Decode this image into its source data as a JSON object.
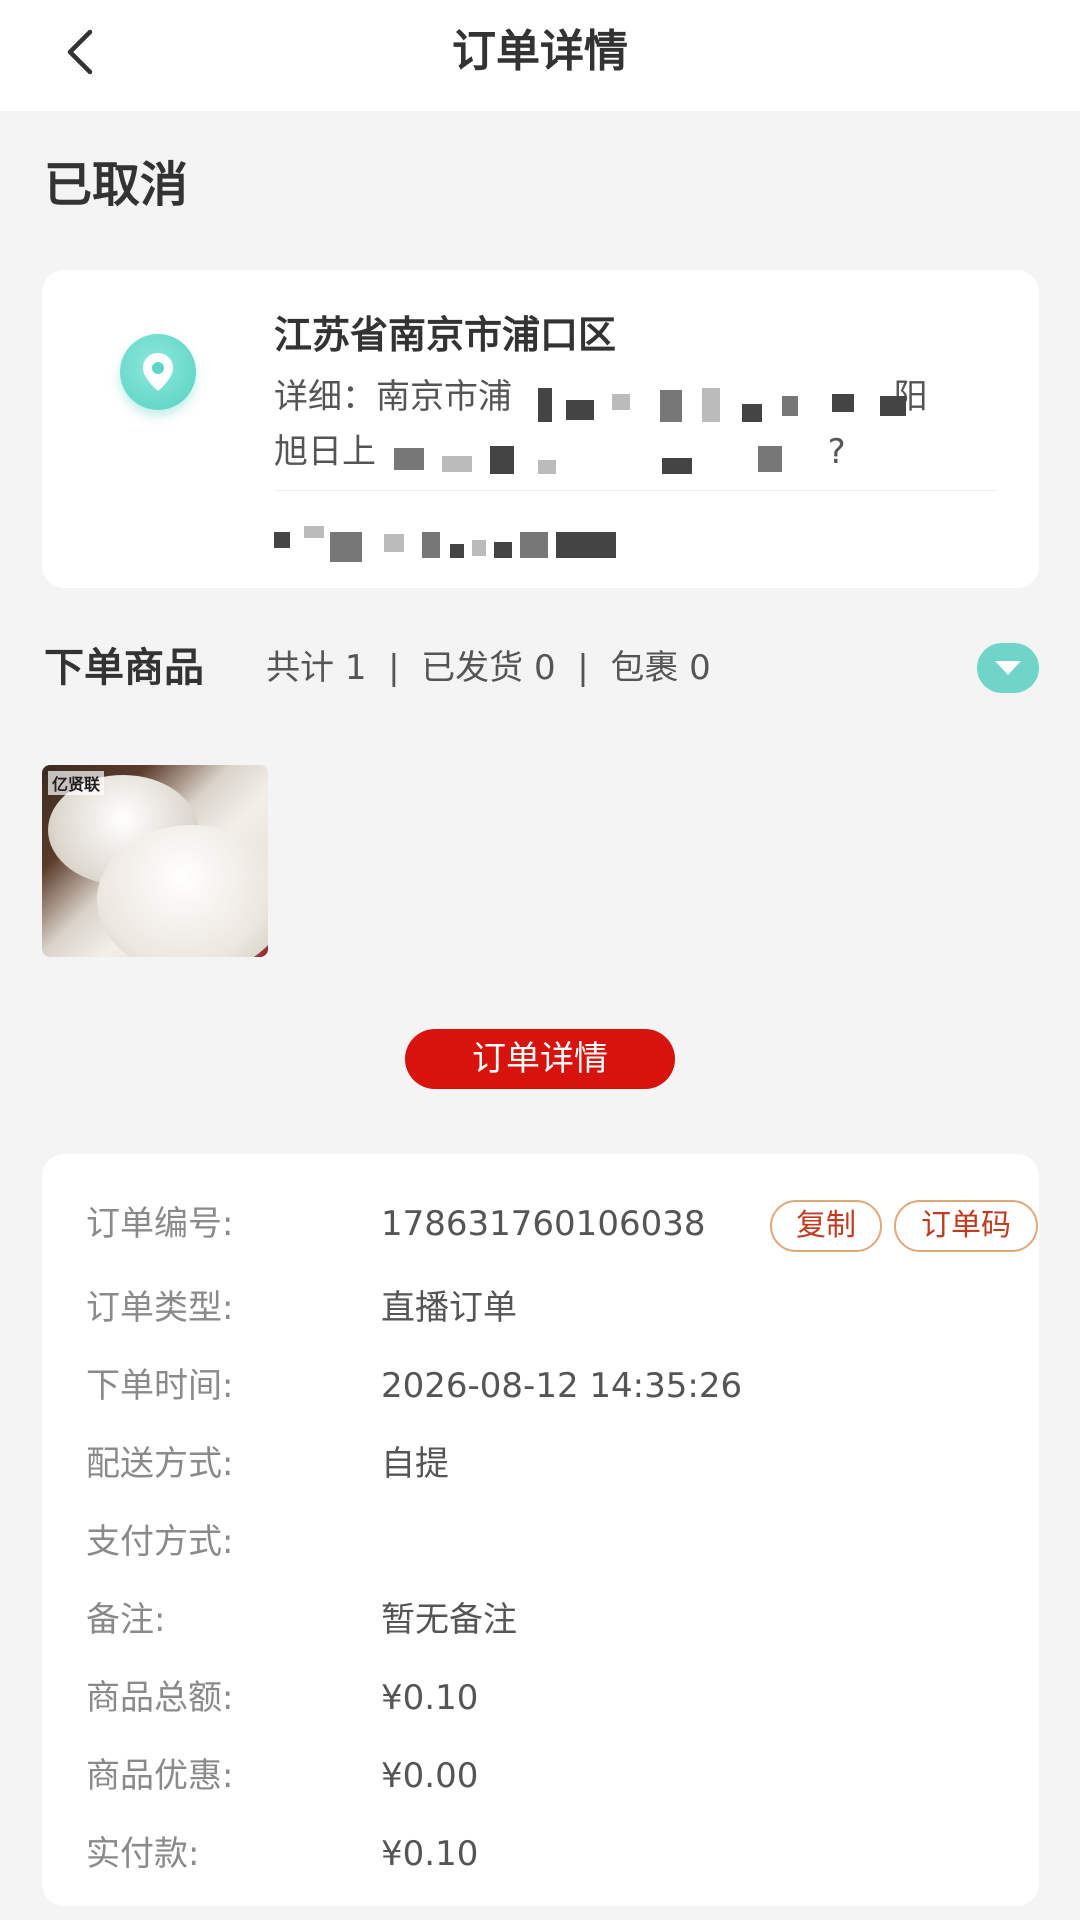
{
  "header": {
    "title": "订单详情"
  },
  "status": "已取消",
  "address": {
    "region": "江苏省南京市浦口区",
    "detail_visible_start": "详细：南京市浦",
    "detail_visible_end_line1": "阳",
    "detail_visible_line2": "旭日上",
    "detail_visible_line2_end": "?"
  },
  "goods": {
    "label": "下单商品",
    "total_label": "共计",
    "total": "1",
    "shipped_label": "已发货",
    "shipped": "0",
    "package_label": "包裹",
    "packages": "0",
    "separator": "|",
    "image_brand": "亿贤联"
  },
  "detail_button": "订单详情",
  "order": {
    "rows": [
      {
        "label": "订单编号:",
        "value": "178631760106038"
      },
      {
        "label": "订单类型:",
        "value": "直播订单"
      },
      {
        "label": "下单时间:",
        "value": "2026-08-12 14:35:26"
      },
      {
        "label": "配送方式:",
        "value": "自提"
      },
      {
        "label": "支付方式:",
        "value": ""
      },
      {
        "label": "备注:",
        "value": "暂无备注"
      },
      {
        "label": "商品总额:",
        "value": "¥0.10"
      },
      {
        "label": "商品优惠:",
        "value": "¥0.00"
      },
      {
        "label": "实付款:",
        "value": "¥0.10"
      }
    ],
    "copy_button": "复制",
    "code_button": "订单码"
  },
  "colors": {
    "accent_red": "#d8120c",
    "teal": "#6fd5c9",
    "pill_border": "#e0a878"
  },
  "icons": {
    "back": "chevron-left-icon",
    "location": "location-pin-icon",
    "expand": "caret-down-icon"
  }
}
